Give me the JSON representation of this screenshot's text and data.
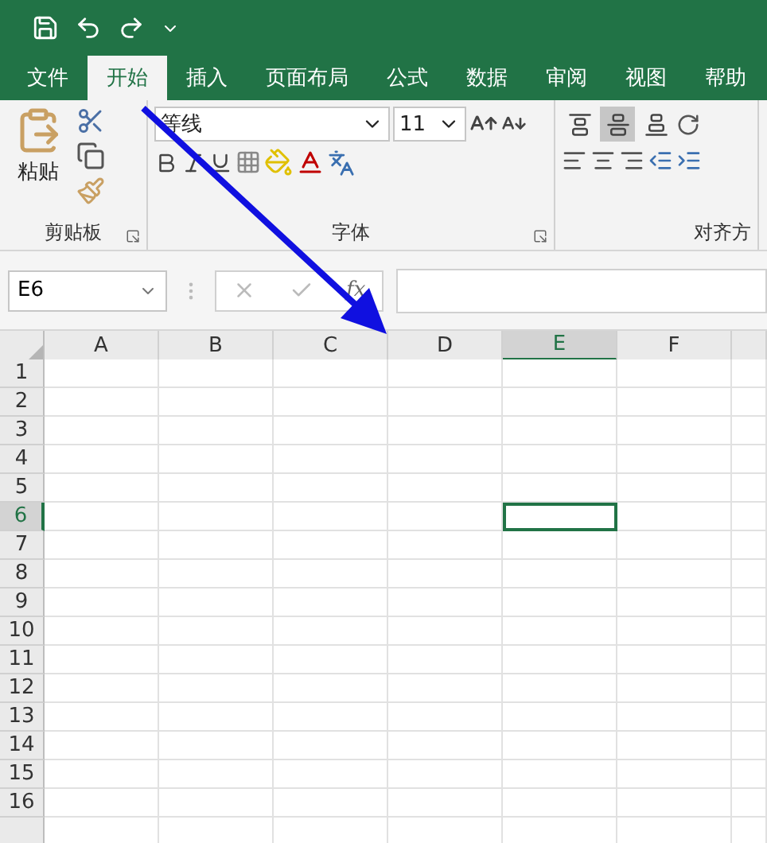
{
  "tabs": [
    {
      "label": "文件",
      "selected": false
    },
    {
      "label": "开始",
      "selected": true
    },
    {
      "label": "插入",
      "selected": false
    },
    {
      "label": "页面布局",
      "selected": false
    },
    {
      "label": "公式",
      "selected": false
    },
    {
      "label": "数据",
      "selected": false
    },
    {
      "label": "审阅",
      "selected": false
    },
    {
      "label": "视图",
      "selected": false
    },
    {
      "label": "帮助",
      "selected": false
    }
  ],
  "ribbon": {
    "clipboard": {
      "paste_label": "粘贴",
      "group_label": "剪贴板"
    },
    "font": {
      "font_name": "等线",
      "font_size": "11",
      "group_label": "字体"
    },
    "alignment": {
      "group_label": "对齐方",
      "buttons": [
        {
          "kind": "top",
          "selected": false
        },
        {
          "kind": "middle",
          "selected": true
        },
        {
          "kind": "bottom",
          "selected": false
        }
      ]
    }
  },
  "formula_bar": {
    "name_box": "E6",
    "function_label": "fx"
  },
  "columns": [
    {
      "label": "A",
      "selected": false
    },
    {
      "label": "B",
      "selected": false
    },
    {
      "label": "C",
      "selected": false
    },
    {
      "label": "D",
      "selected": false
    },
    {
      "label": "E",
      "selected": true
    },
    {
      "label": "F",
      "selected": false
    }
  ],
  "rows": [
    {
      "label": "1",
      "selected": false
    },
    {
      "label": "2",
      "selected": false
    },
    {
      "label": "3",
      "selected": false
    },
    {
      "label": "4",
      "selected": false
    },
    {
      "label": "5",
      "selected": false
    },
    {
      "label": "6",
      "selected": true
    },
    {
      "label": "7",
      "selected": false
    },
    {
      "label": "8",
      "selected": false
    },
    {
      "label": "9",
      "selected": false
    },
    {
      "label": "10",
      "selected": false
    },
    {
      "label": "11",
      "selected": false
    },
    {
      "label": "12",
      "selected": false
    },
    {
      "label": "13",
      "selected": false
    },
    {
      "label": "14",
      "selected": false
    },
    {
      "label": "15",
      "selected": false
    },
    {
      "label": "16",
      "selected": false
    }
  ]
}
